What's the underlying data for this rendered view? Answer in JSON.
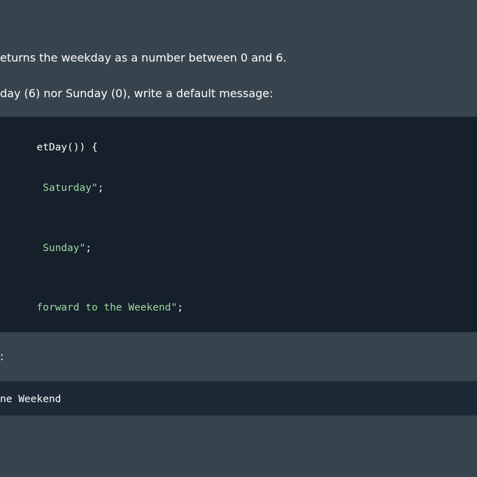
{
  "paragraphs": {
    "p1": "eturns the weekday as a number between 0 and 6.",
    "p2": "day (6) nor Sunday (0), write a default message:"
  },
  "code": {
    "line1": "etDay()) {",
    "line2_str": " Saturday\"",
    "line2_end": ";",
    "line3_str": " Sunday\"",
    "line3_end": ";",
    "line4_str": "forward to the Weekend\"",
    "line4_end": ";"
  },
  "output": {
    "label": ":",
    "text": "ne Weekend"
  }
}
